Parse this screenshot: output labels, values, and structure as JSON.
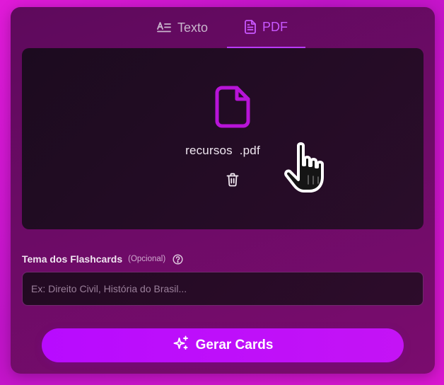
{
  "tabs": {
    "texto": {
      "label": "Texto",
      "icon": "text-lines-icon"
    },
    "pdf": {
      "label": "PDF",
      "icon": "document-icon",
      "active": true
    }
  },
  "upload": {
    "file_name": "recursos  .pdf",
    "file_icon": "file-icon",
    "delete_icon": "trash-icon"
  },
  "topic": {
    "label": "Tema dos Flashcards",
    "optional": "(Opcional)",
    "help_icon": "help-circle-icon",
    "placeholder": "Ex: Direito Civil, História do Brasil...",
    "value": ""
  },
  "actions": {
    "generate_label": "Gerar Cards",
    "generate_icon": "sparkles-icon"
  },
  "colors": {
    "accent": "#b80bff",
    "active_tab": "#c957ff",
    "panel": "#6c0b66",
    "dropzone": "#22091f"
  }
}
